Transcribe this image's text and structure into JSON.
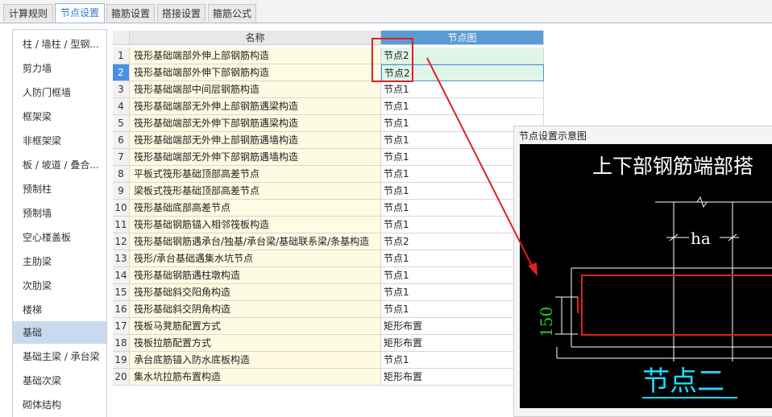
{
  "tabs": [
    {
      "label": "计算规则",
      "active": false
    },
    {
      "label": "节点设置",
      "active": true
    },
    {
      "label": "箍筋设置",
      "active": false
    },
    {
      "label": "搭接设置",
      "active": false
    },
    {
      "label": "箍筋公式",
      "active": false
    }
  ],
  "sidebar": {
    "active": "基础",
    "items": [
      "柱 / 墙柱 / 型钢...",
      "剪力墙",
      "人防门框墙",
      "框架梁",
      "非框架梁",
      "板 / 坡道 / 叠合...",
      "预制柱",
      "预制墙",
      "空心楼盖板",
      "主肋梁",
      "次肋梁",
      "楼梯",
      "基础",
      "基础主梁 / 承台梁",
      "基础次梁",
      "砌体结构"
    ]
  },
  "grid": {
    "columns": [
      "名称",
      "节点图"
    ],
    "rows": [
      {
        "idx": "1",
        "name": "筏形基础端部外伸上部钢筋构造",
        "node": "节点2"
      },
      {
        "idx": "2",
        "name": "筏形基础端部外伸下部钢筋构造",
        "node": "节点2"
      },
      {
        "idx": "3",
        "name": "筏形基础端部中间层钢筋构造",
        "node": "节点1"
      },
      {
        "idx": "4",
        "name": "筏形基础端部无外伸上部钢筋遇梁构造",
        "node": "节点1"
      },
      {
        "idx": "5",
        "name": "筏形基础端部无外伸下部钢筋遇梁构造",
        "node": "节点1"
      },
      {
        "idx": "6",
        "name": "筏形基础端部无外伸上部钢筋遇墙构造",
        "node": "节点1"
      },
      {
        "idx": "7",
        "name": "筏形基础端部无外伸下部钢筋遇墙构造",
        "node": "节点1"
      },
      {
        "idx": "8",
        "name": "平板式筏形基础顶部高差节点",
        "node": "节点1"
      },
      {
        "idx": "9",
        "name": "梁板式筏形基础顶部高差节点",
        "node": "节点1"
      },
      {
        "idx": "10",
        "name": "筏形基础底部高差节点",
        "node": "节点1"
      },
      {
        "idx": "11",
        "name": "筏形基础钢筋锚入相邻筏板构造",
        "node": "节点1"
      },
      {
        "idx": "12",
        "name": "筏形基础钢筋遇承台/独基/承台梁/基础联系梁/条基构造",
        "node": "节点2"
      },
      {
        "idx": "13",
        "name": "筏形/承台基础遇集水坑节点",
        "node": "节点1"
      },
      {
        "idx": "14",
        "name": "筏形基础钢筋遇柱墩构造",
        "node": "节点1"
      },
      {
        "idx": "15",
        "name": "筏形基础斜交阳角构造",
        "node": "节点1"
      },
      {
        "idx": "16",
        "name": "筏形基础斜交阴角构造",
        "node": "节点1"
      },
      {
        "idx": "17",
        "name": "筏板马凳筋配置方式",
        "node": "矩形布置"
      },
      {
        "idx": "18",
        "name": "筏板拉筋配置方式",
        "node": "矩形布置"
      },
      {
        "idx": "19",
        "name": "承台底筋锚入防水底板构造",
        "node": "节点1"
      },
      {
        "idx": "20",
        "name": "集水坑拉筋布置构造",
        "node": "矩形布置"
      }
    ]
  },
  "preview": {
    "title": "节点设置示意图",
    "drawing_title": "上下部钢筋端部搭",
    "dim_ha": "ha",
    "dim_150": "150",
    "node_label": "节点二"
  },
  "colors": {
    "accent_blue": "#5b9bd5",
    "annotation_red": "#e02020",
    "drawing_cyan": "#21d8ff",
    "drawing_green": "#1fd11f"
  }
}
